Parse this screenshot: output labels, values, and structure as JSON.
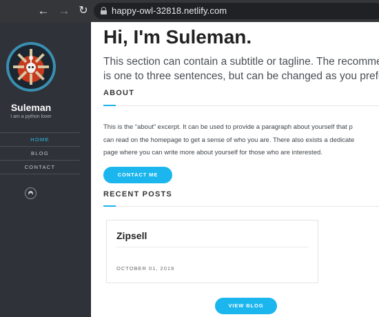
{
  "browser": {
    "url": "happy-owl-32818.netlify.com",
    "icons": [
      "back-arrow-icon",
      "forward-arrow-icon",
      "reload-icon",
      "lock-icon"
    ]
  },
  "sidebar": {
    "name": "Suleman",
    "tagline": "I am a python lover",
    "nav": [
      {
        "label": "HOME",
        "active": true
      },
      {
        "label": "BLOG",
        "active": false
      },
      {
        "label": "CONTACT",
        "active": false
      }
    ],
    "social_icon": "github-icon"
  },
  "main": {
    "title": "Hi, I'm Suleman.",
    "subtitle_lines": [
      "This section can contain a subtitle or tagline. The recommended",
      "is one to three sentences, but can be changed as you prefer."
    ],
    "about": {
      "heading": "ABOUT",
      "lines": [
        "This is the “about” excerpt. It can be used to provide a paragraph about yourself that p",
        "can read on the homepage to get a sense of who you are. There also exists a dedicate",
        "page where you can write more about yourself for those who are interested."
      ],
      "button_label": "CONTACT ME"
    },
    "recent_posts": {
      "heading": "RECENT POSTS",
      "posts": [
        {
          "title": "Zipsell",
          "date": "OCTOBER 01, 2019"
        }
      ],
      "button_label": "VIEW BLOG"
    }
  },
  "colors": {
    "accent": "#1cb6ee",
    "sidebar_bg": "#2f3339",
    "active_nav": "#2bbbe8"
  }
}
